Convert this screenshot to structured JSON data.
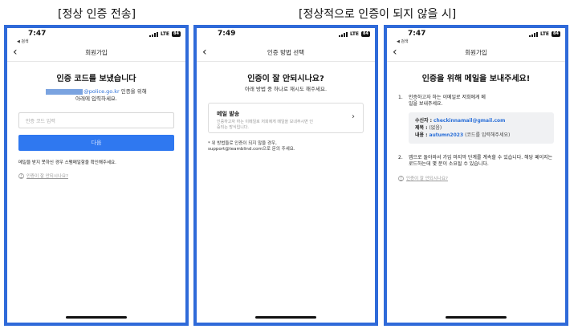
{
  "captions": {
    "left": "[정상 인증 전송]",
    "right": "[정상적으로 인증이 되지 않을 시]"
  },
  "status": {
    "network": "LTE",
    "battery": "84",
    "back_app": "◀ 검색"
  },
  "screen1": {
    "time": "7:47",
    "nav_title": "회원가입",
    "heading": "인증 코드를 보냈습니다",
    "email_domain": "@police.go.kr",
    "sub_suffix": " 인증을 위해",
    "sub_line2": "아래에 입력하세요.",
    "input_placeholder": "인증 코드 입력",
    "next_button": "다음",
    "spam_hint": "메일을 받지 못하신 경우 스팸메일함을 확인해주세요.",
    "help_link": "인증이 잘 안되시나요?"
  },
  "screen2": {
    "time": "7:49",
    "nav_title": "인증 방법 선택",
    "heading": "인증이 잘 안되시나요?",
    "sub": "아래 방법 중 하나로 재시도 해주세요.",
    "card_title": "메일 발송",
    "card_desc": "인증하고자 하는 이메일로 저희에게 메일을 보내주시면 인증되는 방식입니다.",
    "note_line1": "* 위 방법들로 인증이 되지 않을 경우,",
    "note_line2": "support@teamblind.com으로 문의 주세요."
  },
  "screen3": {
    "time": "7:47",
    "nav_title": "회원가입",
    "heading": "인증을 위해 메일을 보내주세요!",
    "step1_num": "1.",
    "step1_text": "인증하고자 하는 이메일로 저희에게 메일을 보내주세요.",
    "recipient_label": "수신자 :",
    "recipient_value": "checkinnamail@gmail.com",
    "subject_label": "제목 :",
    "subject_value": "(없음)",
    "body_label": "내용 :",
    "body_value": "autumn2023",
    "body_note": "(코드를 입력해주세요)",
    "step2_num": "2.",
    "step2_text": "앱으로 돌아와서 가입 마지막 단계를 계속할 수 있습니다. 해당 페이지는 로드하는데 몇 분이 소요될 수 있습니다.",
    "help_link": "인증이 잘 안되시나요?"
  },
  "icons": {
    "back": "chevron-left",
    "card_arrow": "chevron-right",
    "help": "question-circle"
  },
  "colors": {
    "frame": "#2f6ad9",
    "primary": "#2f78f0",
    "link_blue": "#2a6fd8"
  }
}
